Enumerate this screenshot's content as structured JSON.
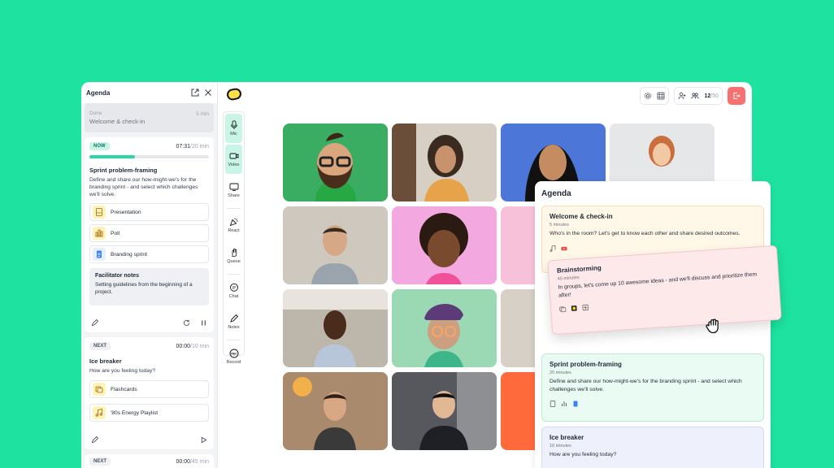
{
  "agenda": {
    "title": "Agenda",
    "done": {
      "label": "Done",
      "title": "Welcome & check-in",
      "duration": "5 min"
    },
    "current": {
      "badge": "NOW",
      "elapsed": "07:31",
      "total": "/20 min",
      "progress": 0.38,
      "title": "Sprint problem-framing",
      "description": "Define and share our how-might-we's for the branding sprint - and select which challenges we'll solve.",
      "resources": [
        {
          "label": "Presentation",
          "icon": "pdf-icon"
        },
        {
          "label": "Poll",
          "icon": "poll-icon"
        },
        {
          "label": "Branding sprint",
          "icon": "document-icon"
        }
      ],
      "notes_title": "Facilitator notes",
      "notes_text": "Setting guidelines from the beginning of a project."
    },
    "next1": {
      "badge": "NEXT",
      "elapsed": "00:00",
      "total": "/10 min",
      "title": "Ice breaker",
      "description": "How are you feeling today?",
      "resources": [
        {
          "label": "Flashcards",
          "icon": "flashcards-icon"
        },
        {
          "label": "'80s Energy Playlist",
          "icon": "music-icon"
        }
      ]
    },
    "next2": {
      "badge": "NEXT",
      "elapsed": "00:00",
      "total": "/45 min"
    }
  },
  "toolbar": {
    "mic": "Mic",
    "video": "Video",
    "share": "Share",
    "react": "React",
    "queue": "Queue",
    "chat": "Chat",
    "notes": "Notes",
    "record": "Record"
  },
  "header": {
    "participants": "12",
    "participants_total": "/50"
  },
  "floating_agenda": {
    "title": "Agenda",
    "items": [
      {
        "title": "Welcome & check-in",
        "duration": "5 minutes",
        "description": "Who's in the room? Let's get to know each other and share desired outcomes."
      },
      {
        "title": "Brainstorming",
        "duration": "45 minutes",
        "description": "In groups, let's come up 10 awesome ideas - and we'll discuss and prioritize them after!"
      },
      {
        "title": "Sprint problem-framing",
        "duration": "20 minutes",
        "description": "Define and share our how-might-we's for the branding sprint - and select which challenges we'll solve."
      },
      {
        "title": "Ice breaker",
        "duration": "10 minutes",
        "description": "How are you feeling today?"
      }
    ]
  },
  "colors": {
    "background": "#1ee3a0",
    "accent": "#2dd4a6",
    "leave": "#f87171"
  }
}
